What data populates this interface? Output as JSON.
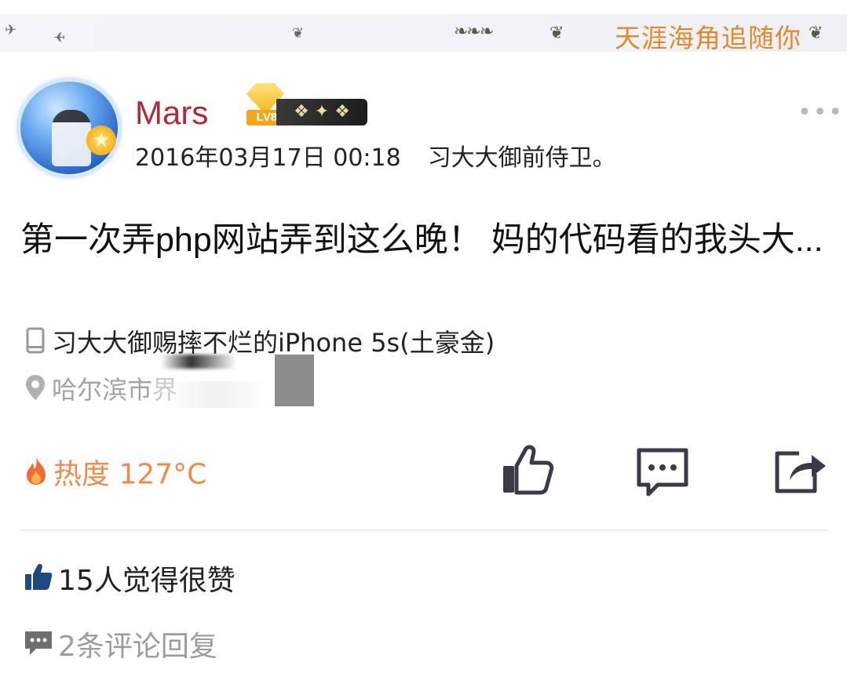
{
  "banner": {
    "decoration_text": "天涯海角追随你",
    "bird_icon": "bird-icon",
    "leaf_icon": "leaf-branch-icon"
  },
  "post": {
    "author": {
      "name": "Mars",
      "level_badge": "LV8",
      "avatar_icon": "avatar-image",
      "vip_badge_icon": "star-badge-icon",
      "wing_badge_icon": "wing-medal-icon"
    },
    "date": "2016年03月17日 00:18",
    "signature": "习大大御前侍卫。",
    "content": "第一次弄php网站弄到这么晚！ 妈的代码看的我头大...",
    "device": "习大大御赐摔不烂的iPhone 5s(土豪金)",
    "location": "哈尔滨市",
    "location_suffix": "界",
    "heat": "热度 127°C",
    "more_icon": "more-dots-icon"
  },
  "actions": {
    "like_icon": "thumbs-up-icon",
    "comment_icon": "comment-bubble-icon",
    "share_icon": "share-icon"
  },
  "stats": {
    "likes": "15人觉得很赞",
    "comments": "2条评论回复"
  },
  "colors": {
    "username": "#b4283a",
    "heat": "#f08a4b",
    "banner_text": "#e08a2c",
    "icon_dark": "#3a3a48",
    "like_icon_blue": "#1f4a80",
    "muted": "#9c9c9c"
  }
}
